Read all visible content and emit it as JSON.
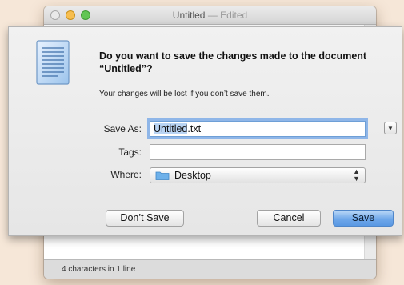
{
  "window": {
    "title": "Untitled",
    "title_separator": "—",
    "title_status": "Edited"
  },
  "status_bar": {
    "text": "4 characters in 1 line"
  },
  "dialog": {
    "question": "Do you want to save the changes made to the document “Untitled”?",
    "info": "Your changes will be lost if you don’t save them.",
    "save_as": {
      "label": "Save As:",
      "name_selected": "Untitled",
      "extension": ".txt"
    },
    "tags": {
      "label": "Tags:",
      "value": ""
    },
    "where": {
      "label": "Where:",
      "value": "Desktop"
    },
    "buttons": {
      "dont_save": "Don’t Save",
      "cancel": "Cancel",
      "save": "Save"
    }
  },
  "colors": {
    "backdrop": "#f6e7d8",
    "accent": "#5998e3",
    "selection": "#b9d4f4"
  },
  "icons": [
    "text-document-icon",
    "folder-icon",
    "disclosure-triangle-icon",
    "updown-arrows-icon"
  ]
}
